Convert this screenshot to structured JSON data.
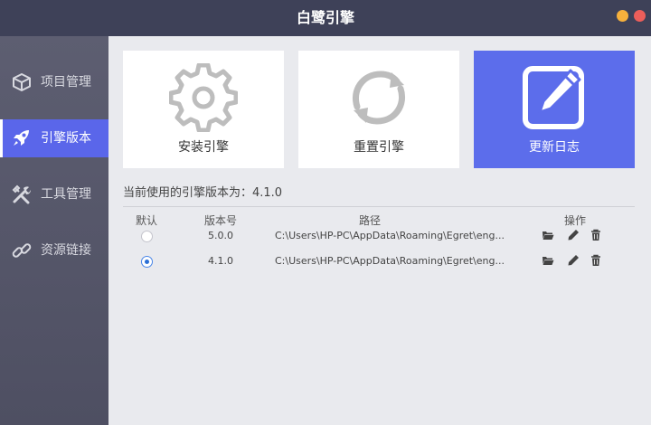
{
  "window": {
    "title": "白鹭引擎"
  },
  "sidebar": {
    "items": [
      {
        "label": "项目管理",
        "icon": "cube-icon",
        "active": false
      },
      {
        "label": "引擎版本",
        "icon": "rocket-icon",
        "active": true
      },
      {
        "label": "工具管理",
        "icon": "tools-icon",
        "active": false
      },
      {
        "label": "资源链接",
        "icon": "link-icon",
        "active": false
      }
    ]
  },
  "actions": [
    {
      "label": "安装引擎",
      "icon": "gear-icon"
    },
    {
      "label": "重置引擎",
      "icon": "refresh-icon"
    },
    {
      "label": "更新日志",
      "icon": "edit-log-icon"
    }
  ],
  "current_version_text": "当前使用的引擎版本为：4.1.0",
  "table": {
    "headers": {
      "default": "默认",
      "version": "版本号",
      "path": "路径",
      "ops": "操作"
    },
    "rows": [
      {
        "selected": false,
        "version": "5.0.0",
        "path": "C:\\Users\\HP-PC\\AppData\\Roaming\\Egret\\eng..."
      },
      {
        "selected": true,
        "version": "4.1.0",
        "path": "C:\\Users\\HP-PC\\AppData\\Roaming\\Egret\\eng..."
      }
    ]
  },
  "colors": {
    "accent": "#5c6deb",
    "sidebar": "#55566a",
    "titlebar": "#3e4158",
    "background": "#e9eaee"
  }
}
